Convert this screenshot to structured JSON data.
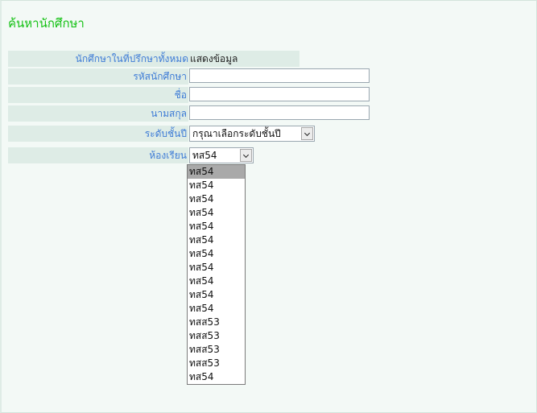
{
  "page": {
    "title": "ค้นหานักศึกษา"
  },
  "form": {
    "advisees": {
      "label": "นักศึกษาในที่ปรึกษาทั้งหมด",
      "link": "แสดงข้อมูล"
    },
    "student_id": {
      "label": "รหัสนักศึกษา",
      "value": ""
    },
    "first_name": {
      "label": "ชื่อ",
      "value": ""
    },
    "last_name": {
      "label": "นามสกุล",
      "value": ""
    },
    "year_level": {
      "label": "ระดับชั้นปี",
      "selected": "กรุณาเลือกระดับชั้นปี"
    },
    "classroom": {
      "label": "ห้องเรียน",
      "selected": "ทส54",
      "options": [
        "ทส54",
        "ทส54",
        "ทส54",
        "ทส54",
        "ทส54",
        "ทส54",
        "ทส54",
        "ทส54",
        "ทส54",
        "ทส54",
        "ทส54",
        "ทสส53",
        "ทสส53",
        "ทสส53",
        "ทสส53",
        "ทส54"
      ],
      "highlighted_index": 0
    }
  },
  "icons": {
    "select_arrow": "chevron-down-icon"
  },
  "colors": {
    "title": "#14c114",
    "label": "#3d7bd6",
    "label_bg": "#deece6",
    "panel_bg": "#f3f9f6",
    "option_highlight": "#a9a9a9"
  }
}
